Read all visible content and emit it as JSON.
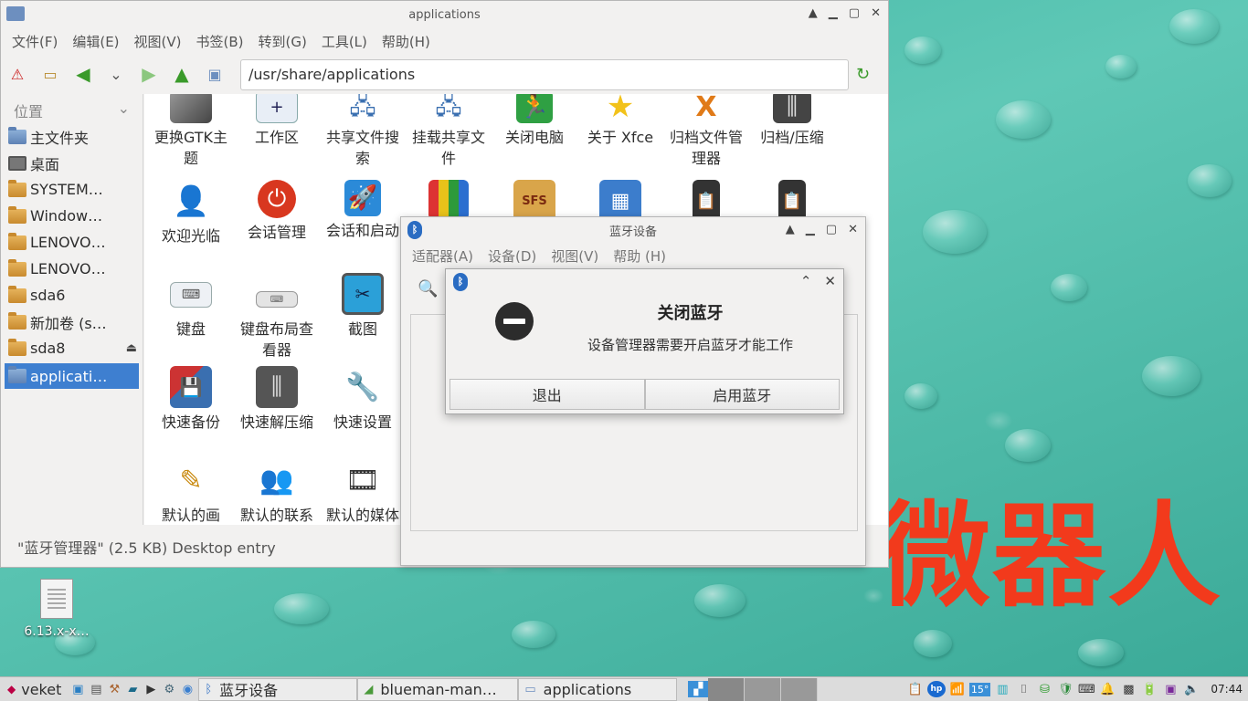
{
  "fm": {
    "title": "applications",
    "menu": [
      "文件(F)",
      "编辑(E)",
      "视图(V)",
      "书签(B)",
      "转到(G)",
      "工具(L)",
      "帮助(H)"
    ],
    "path": "/usr/share/applications",
    "sidebar_header": "位置",
    "sidebar": [
      "主文件夹",
      "桌面",
      "SYSTEM…",
      "Window…",
      "LENOVO…",
      "LENOVO…",
      "sda6",
      "新加卷 (s…",
      "sda8",
      "applicati…"
    ],
    "icons": [
      "更换GTK主题",
      "工作区",
      "共享文件搜索",
      "挂载共享文件",
      "关闭电脑",
      "关于 Xfce",
      "归档文件管理器",
      "归档/压缩",
      "欢迎光临",
      "会话管理",
      "会话和启动",
      "键盘",
      "键盘布局查看器",
      "截图",
      "快速备份",
      "快速解压缩",
      "快速设置",
      "默认的画",
      "默认的联系",
      "默认的媒体"
    ],
    "status": "\"蓝牙管理器\" (2.5 KB) Desktop entry"
  },
  "bt": {
    "title": "蓝牙设备",
    "menu": [
      "适配器(A)",
      "设备(D)",
      "视图(V)",
      "帮助 (H)"
    ]
  },
  "dialog": {
    "title": "关闭蓝牙",
    "message": "设备管理器需要开启蓝牙才能工作",
    "quit": "退出",
    "enable": "启用蓝牙"
  },
  "desktop": {
    "watermark": "微器人",
    "file": "6.13.x-x…"
  },
  "taskbar": {
    "start": "veket",
    "tasks": [
      "蓝牙设备",
      "blueman-man…",
      "applications"
    ],
    "temp": "15°",
    "clock": "07:44"
  }
}
